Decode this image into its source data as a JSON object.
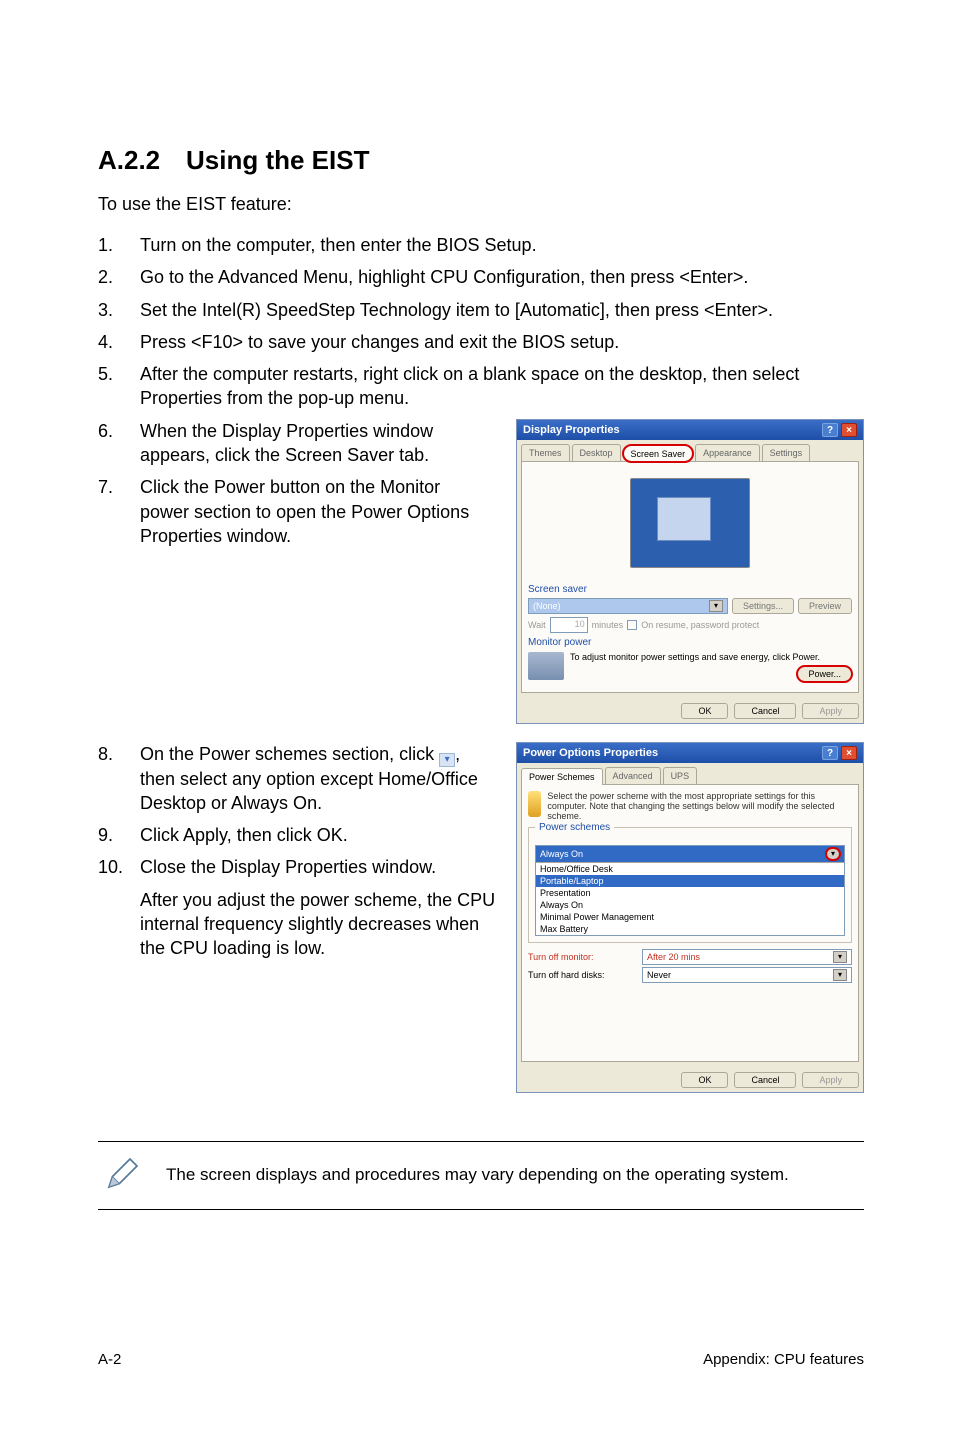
{
  "heading": {
    "number": "A.2.2",
    "title": "Using the EIST"
  },
  "intro": "To use the EIST feature:",
  "steps": [
    {
      "n": "1.",
      "t": "Turn on the computer, then enter the BIOS Setup."
    },
    {
      "n": "2.",
      "t": "Go to the Advanced Menu, highlight CPU Configuration, then press <Enter>."
    },
    {
      "n": "3.",
      "t": "Set the Intel(R) SpeedStep Technology item to [Automatic], then press <Enter>."
    },
    {
      "n": "4.",
      "t": "Press <F10> to save your changes and exit the BIOS setup."
    },
    {
      "n": "5.",
      "t": "After the computer restarts, right click on a blank space on the desktop, then select Properties from the pop-up menu."
    },
    {
      "n": "6.",
      "t": "When the Display Properties window appears, click the Screen Saver tab."
    },
    {
      "n": "7.",
      "t": "Click the Power button on the Monitor power section to open the Power Options Properties window."
    },
    {
      "n": "8.",
      "t": "On the Power schemes section, click ",
      "t2": ", then select any option except Home/Office Desktop or Always On."
    },
    {
      "n": "9.",
      "t": "Click Apply, then click OK."
    },
    {
      "n": "10.",
      "t": "Close the Display Properties window."
    }
  ],
  "after10": "After you adjust the power scheme, the CPU internal frequency slightly decreases when the CPU loading is low.",
  "note": "The screen displays and procedures may vary depending on the operating system.",
  "footer": {
    "left": "A-2",
    "right": "Appendix: CPU features"
  },
  "display_properties": {
    "title": "Display Properties",
    "tabs": [
      "Themes",
      "Desktop",
      "Screen Saver",
      "Appearance",
      "Settings"
    ],
    "active_tab": "Screen Saver",
    "screen_saver": {
      "section": "Screen saver",
      "selection": "(None)",
      "settings_btn": "Settings...",
      "preview_btn": "Preview",
      "wait_label": "Wait",
      "wait_value": "10",
      "wait_unit": "minutes",
      "on_resume": "On resume, password protect"
    },
    "monitor_power": {
      "section": "Monitor power",
      "desc": "To adjust monitor power settings and save energy, click Power.",
      "button": "Power..."
    },
    "buttons": {
      "ok": "OK",
      "cancel": "Cancel",
      "apply": "Apply"
    }
  },
  "power_options": {
    "title": "Power Options Properties",
    "tabs": [
      "Power Schemes",
      "Advanced",
      "UPS"
    ],
    "active_tab": "Power Schemes",
    "desc": "Select the power scheme with the most appropriate settings for this computer. Note that changing the settings below will modify the selected scheme.",
    "schemes_label": "Power schemes",
    "selected": "Always On",
    "options": [
      "Home/Office Desk",
      "Portable/Laptop",
      "Presentation",
      "Always On",
      "Minimal Power Management",
      "Max Battery"
    ],
    "highlight": "Portable/Laptop",
    "settings": {
      "monitor_label": "Turn off monitor:",
      "monitor_val": "After 20 mins",
      "hdd_label": "Turn off hard disks:",
      "hdd_val": "Never"
    },
    "buttons": {
      "ok": "OK",
      "cancel": "Cancel",
      "apply": "Apply"
    }
  }
}
